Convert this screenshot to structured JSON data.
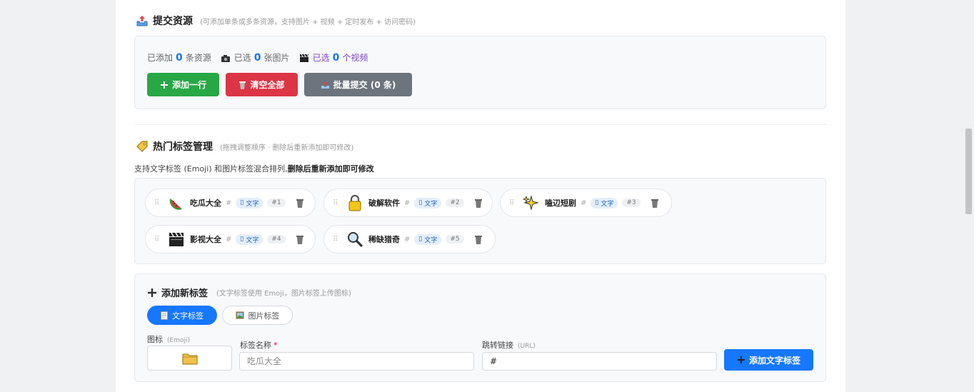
{
  "submit": {
    "title": "提交资源",
    "hint": "(可添加单条或多条资源，支持图片 + 视频 + 定时发布 + 访问密码)",
    "stats": {
      "added_prefix": "已添加",
      "added_count": "0",
      "added_suffix": "条资源",
      "images_prefix": "已选",
      "images_count": "0",
      "images_suffix": "张图片",
      "videos_prefix": "已选",
      "videos_count": "0",
      "videos_suffix": "个视频"
    },
    "buttons": {
      "add_row": "添加一行",
      "clear_all": "清空全部",
      "batch_submit": "批量提交 (0 条)"
    },
    "colors": {
      "green": "#28a745",
      "red": "#dc3545",
      "gray": "#6c757d",
      "blue": "#1677ff"
    }
  },
  "hot_tags": {
    "title": "热门标签管理",
    "hint": "(拖拽调整顺序 · 删除后重新添加即可修改)",
    "desc_normal": "支持文字标签 (Emoji) 和图片标签混合排列,",
    "desc_bold": "删除后重新添加即可修改",
    "hash": "#",
    "items": [
      {
        "icon": "watermelon-icon",
        "name": "吃瓜大全",
        "type": "文字",
        "index": "#1"
      },
      {
        "icon": "lock-icon",
        "name": "破解软件",
        "type": "文字",
        "index": "#2"
      },
      {
        "icon": "sparkles-icon",
        "name": "嗑辺短剧",
        "type": "文字",
        "index": "#3"
      },
      {
        "icon": "clapper-board-icon",
        "name": "影视大全",
        "type": "文字",
        "index": "#4"
      },
      {
        "icon": "magnifier-icon",
        "name": "稀缺猎奇",
        "type": "文字",
        "index": "#5"
      }
    ]
  },
  "add_tag": {
    "title": "添加新标签",
    "hint": "(文字标签使用 Emoji，图片标签上传图标)",
    "tabs": {
      "text": "文字标签",
      "image": "图片标签"
    },
    "icon_label": "图标",
    "icon_sub": "(Emoji)",
    "icon_value": "folder-icon",
    "name_label": "标签名称",
    "name_required": "*",
    "name_placeholder": "吃瓜大全",
    "link_label": "跳转链接",
    "link_sub": "(URL)",
    "link_value": "#",
    "submit": "添加文字标签"
  }
}
